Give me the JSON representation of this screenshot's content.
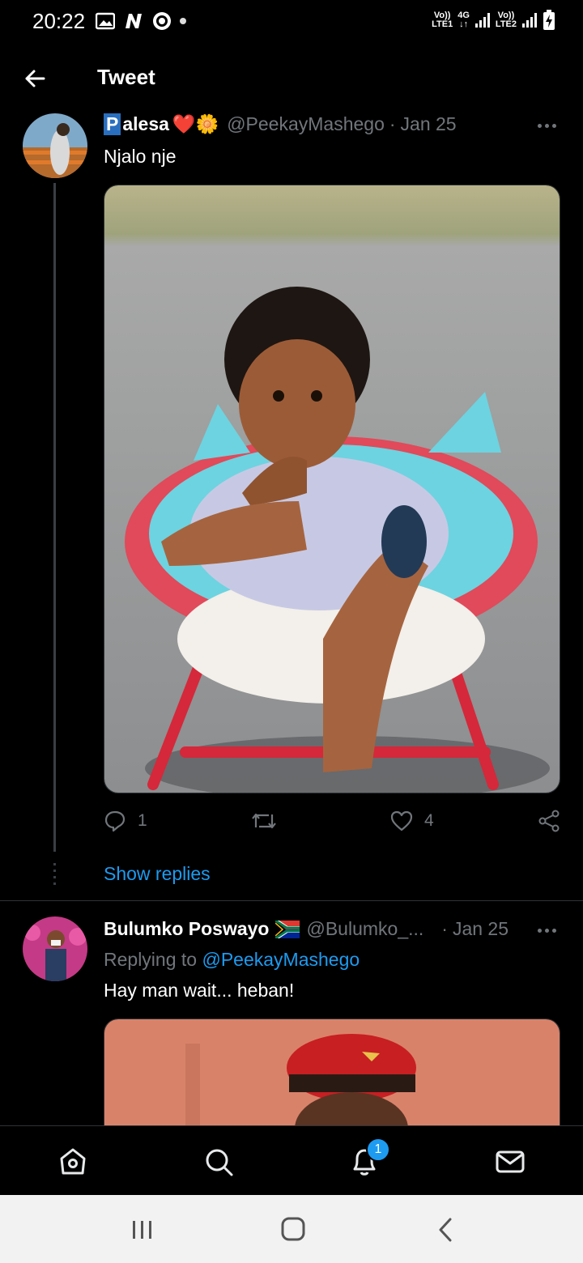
{
  "status_bar": {
    "time": "20:22",
    "sim1_top": "Vo))",
    "sim1_bottom": "LTE1",
    "network": "4G",
    "sim2_top": "Vo))",
    "sim2_bottom": "LTE2"
  },
  "header": {
    "title": "Tweet"
  },
  "tweets": [
    {
      "display_name_initial": "P",
      "display_name_rest": "alesa",
      "emoji": "❤️🌼",
      "handle": "@PeekayMashego",
      "separator": "·",
      "date": "Jan 25",
      "text": "Njalo nje",
      "actions": {
        "reply_count": "1",
        "retweet_count": "",
        "like_count": "4"
      },
      "show_replies": "Show replies"
    },
    {
      "display_name": "Bulumko Poswayo",
      "handle": "@Bulumko_...",
      "separator": "·",
      "date": "Jan 25",
      "replying_prefix": "Replying to ",
      "replying_handle": "@PeekayMashego",
      "text": "Hay man wait... heban!"
    }
  ],
  "bottom_nav": {
    "items": [
      "home-icon",
      "search-icon",
      "notifications-icon",
      "messages-icon"
    ],
    "notification_badge": "1"
  },
  "colors": {
    "accent": "#1d9bf0",
    "muted": "#71767b",
    "background": "#000000"
  }
}
